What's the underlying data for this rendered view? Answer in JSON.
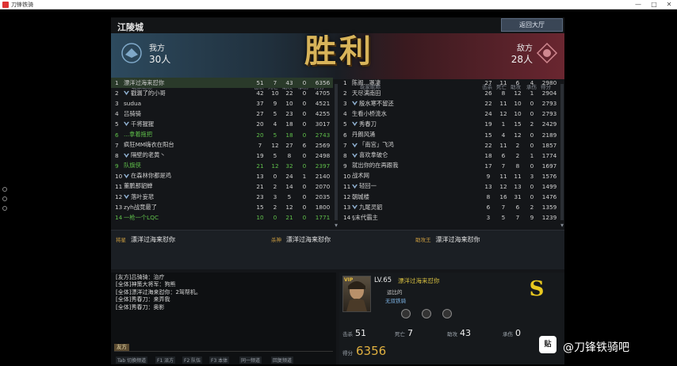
{
  "window": {
    "title": "刀锋铁骑"
  },
  "top": {
    "city": "江陵城",
    "return_button": "返回大厅"
  },
  "banner": {
    "victory_text": "胜利"
  },
  "our_team": {
    "label": "我方",
    "count": "30人"
  },
  "enemy_team": {
    "label": "敌方",
    "count": "28人"
  },
  "left_header": {
    "name": "玩家昵称",
    "kills": "击杀",
    "deaths": "死亡",
    "assists": "助攻",
    "damage": "承伤",
    "score": "得分"
  },
  "right_header": {
    "name": "玩家昵称",
    "kills": "击杀",
    "deaths": "死亡",
    "assists": "助攻",
    "damage": "承伤",
    "score": "得分"
  },
  "left_rows": [
    {
      "rank": "1",
      "name": "漂洋过海来怼你",
      "k": "51",
      "d": "7",
      "a": "43",
      "dm": "0",
      "s": "6356",
      "style": "hl"
    },
    {
      "rank": "2",
      "name": "戳漏了的小哥",
      "k": "42",
      "d": "10",
      "a": "22",
      "dm": "0",
      "s": "4705",
      "style": "",
      "icon": true
    },
    {
      "rank": "3",
      "name": "sudua",
      "k": "37",
      "d": "9",
      "a": "10",
      "dm": "0",
      "s": "4521",
      "style": ""
    },
    {
      "rank": "4",
      "name": "吕骑骑",
      "k": "27",
      "d": "5",
      "a": "23",
      "dm": "0",
      "s": "4255",
      "style": ""
    },
    {
      "rank": "5",
      "name": "千将猩猩",
      "k": "20",
      "d": "4",
      "a": "18",
      "dm": "0",
      "s": "3017",
      "style": "",
      "icon": true
    },
    {
      "rank": "6",
      "name": "...拿着拖把",
      "k": "20",
      "d": "5",
      "a": "18",
      "dm": "0",
      "s": "2743",
      "style": "green"
    },
    {
      "rank": "7",
      "name": "疯狂MM嗨衣在阳台",
      "k": "7",
      "d": "12",
      "a": "27",
      "dm": "6",
      "s": "2569",
      "style": ""
    },
    {
      "rank": "8",
      "name": "隔壁的老黄丶",
      "k": "19",
      "d": "5",
      "a": "8",
      "dm": "0",
      "s": "2498",
      "style": "",
      "icon": true
    },
    {
      "rank": "9",
      "name": "队旗侠",
      "k": "21",
      "d": "12",
      "a": "32",
      "dm": "0",
      "s": "2397",
      "style": "green"
    },
    {
      "rank": "10",
      "name": "在森林你都是鸡",
      "k": "13",
      "d": "0",
      "a": "24",
      "dm": "1",
      "s": "2140",
      "style": "",
      "icon": true
    },
    {
      "rank": "11",
      "name": "董鹏那貂蝉",
      "k": "21",
      "d": "2",
      "a": "14",
      "dm": "0",
      "s": "2070",
      "style": ""
    },
    {
      "rank": "12",
      "name": "落叶妄悲",
      "k": "23",
      "d": "3",
      "a": "5",
      "dm": "0",
      "s": "2035",
      "style": "",
      "icon": true
    },
    {
      "rank": "13",
      "name": "zyh战竞最了",
      "k": "15",
      "d": "2",
      "a": "12",
      "dm": "0",
      "s": "1800",
      "style": ""
    },
    {
      "rank": "14",
      "name": "一枪一个LQC",
      "k": "10",
      "d": "0",
      "a": "21",
      "dm": "0",
      "s": "1771",
      "style": "green"
    }
  ],
  "right_rows": [
    {
      "rank": "1",
      "name": "陈阁...罩凄",
      "k": "27",
      "d": "11",
      "a": "6",
      "dm": "4",
      "s": "2980",
      "style": ""
    },
    {
      "rank": "2",
      "name": "天尽满南田",
      "k": "26",
      "d": "8",
      "a": "12",
      "dm": "1",
      "s": "2904",
      "style": ""
    },
    {
      "rank": "3",
      "name": "殷水寒不留还",
      "k": "22",
      "d": "11",
      "a": "10",
      "dm": "0",
      "s": "2793",
      "style": "",
      "icon": true
    },
    {
      "rank": "4",
      "name": "生看小桥流水",
      "k": "24",
      "d": "12",
      "a": "10",
      "dm": "0",
      "s": "2793",
      "style": ""
    },
    {
      "rank": "5",
      "name": "秀春刀",
      "k": "19",
      "d": "1",
      "a": "15",
      "dm": "2",
      "s": "2429",
      "style": "",
      "icon": true
    },
    {
      "rank": "6",
      "name": "丹朗风涌",
      "k": "15",
      "d": "4",
      "a": "12",
      "dm": "0",
      "s": "2189",
      "style": ""
    },
    {
      "rank": "7",
      "name": "「南宫」飞鸿",
      "k": "22",
      "d": "11",
      "a": "2",
      "dm": "0",
      "s": "1857",
      "style": "",
      "icon": true
    },
    {
      "rank": "8",
      "name": "喜欢拿破仑",
      "k": "18",
      "d": "6",
      "a": "2",
      "dm": "1",
      "s": "1774",
      "style": "",
      "icon": true
    },
    {
      "rank": "9",
      "name": "就出你的在再跟我",
      "k": "17",
      "d": "7",
      "a": "8",
      "dm": "0",
      "s": "1697",
      "style": ""
    },
    {
      "rank": "10",
      "name": "战术网",
      "k": "9",
      "d": "11",
      "a": "11",
      "dm": "3",
      "s": "1576",
      "style": ""
    },
    {
      "rank": "11",
      "name": "轻回一",
      "k": "13",
      "d": "12",
      "a": "13",
      "dm": "0",
      "s": "1499",
      "style": "",
      "icon": true
    },
    {
      "rank": "12",
      "name": "朝城楼",
      "k": "8",
      "d": "16",
      "a": "31",
      "dm": "0",
      "s": "1476",
      "style": ""
    },
    {
      "rank": "13",
      "name": "九尾灵貂",
      "k": "6",
      "d": "7",
      "a": "6",
      "dm": "2",
      "s": "1359",
      "style": "",
      "icon": true
    },
    {
      "rank": "14",
      "name": "§末代霸主",
      "k": "3",
      "d": "5",
      "a": "7",
      "dm": "9",
      "s": "1239",
      "style": ""
    }
  ],
  "mvp": [
    {
      "label": "将星",
      "name": "漂洋过海来怼你"
    },
    {
      "label": "杀神",
      "name": "漂洋过海来怼你"
    },
    {
      "label": "助攻王",
      "name": "漂洋过海来怼你"
    }
  ],
  "chat": {
    "lines": [
      "[友方]吕骑骑：治疗",
      "[全体]神策大将军：狗熊",
      "[全体]漂洋过海来怼你：2驾帮机。",
      "[全体]秀春刀：来弄我",
      "[全体]秀春刀：奥影"
    ],
    "tab": "友方",
    "hotkeys": [
      "Tab 切换频道",
      "F1 派方",
      "F2 队伍",
      "F3 本体",
      "同一频道",
      "回复频道"
    ]
  },
  "player": {
    "vip": "VIP",
    "level": "LV.65",
    "name": "漂洋过海来怼你",
    "guild": "运比的",
    "guild_tag": "无双铁骑",
    "grade": "S",
    "kills_label": "击杀",
    "kills": "51",
    "deaths_label": "死亡",
    "deaths": "7",
    "assists_label": "助攻",
    "assists": "43",
    "damage_label": "承伤",
    "damage": "0",
    "score_label": "得分",
    "score": "6356"
  },
  "watermark": {
    "text": "@刀锋铁骑吧",
    "logo": "贴",
    "small": "刀锋铁骑"
  }
}
